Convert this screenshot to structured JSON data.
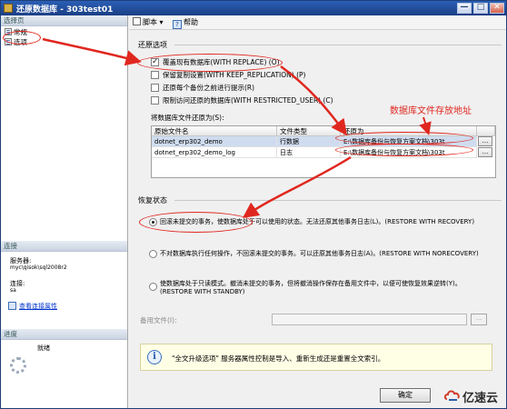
{
  "window": {
    "title": "还原数据库 - 303test01",
    "buttons": [
      "—",
      "□",
      "✕"
    ]
  },
  "left_pane": {
    "select_page_header": "选择页",
    "pages": [
      {
        "label": "常规"
      },
      {
        "label": "选项"
      }
    ],
    "connection_header": "连接",
    "server_label": "服务器:",
    "server_value": "myc\\qisok\\sql2008r2",
    "connection_label": "连接:",
    "connection_value": "sa",
    "view_connection_link": "查看连接属性",
    "progress_header": "进度",
    "progress_status": "就绪"
  },
  "toolbar": {
    "script_label": "脚本",
    "help_label": "帮助"
  },
  "restore_options": {
    "title": "还原选项",
    "options": [
      {
        "label": "覆盖现有数据库(WITH REPLACE) (O)",
        "checked": true
      },
      {
        "label": "保留复制设置(WITH KEEP_REPLICATION) (P)",
        "checked": false
      },
      {
        "label": "还原每个备份之前进行提示(R)",
        "checked": false
      },
      {
        "label": "限制访问还原的数据库(WITH RESTRICTED_USER) (C)",
        "checked": false
      }
    ],
    "restore_as_label": "将数据库文件还原为(S):",
    "grid": {
      "headers": [
        "原始文件名",
        "文件类型",
        "还原为",
        ""
      ],
      "rows": [
        {
          "original": "dotnet_erp302_demo",
          "type": "行数据",
          "restore_as": "E:\\数据库备份与恢复方案文档\\303t",
          "button": "..."
        },
        {
          "original": "dotnet_erp302_demo_log",
          "type": "日志",
          "restore_as": "E:\\数据库备份与恢复方案文档\\303t",
          "button": "..."
        }
      ]
    }
  },
  "recovery_state": {
    "title": "恢复状态",
    "options": [
      {
        "label": "回滚未提交的事务，使数据库处于可以使用的状态。无法还原其他事务日志(L)。(RESTORE WITH RECOVERY)",
        "selected": true
      },
      {
        "label": "不对数据库执行任何操作，不回滚未提交的事务。可以还原其他事务日志(A)。(RESTORE WITH NORECOVERY)",
        "selected": false
      },
      {
        "label_line1": "使数据库处于只读模式。撤消未提交的事务，但将撤消操作保存在备用文件中，以便可使恢复效果逆转(Y)。",
        "label_line2": "(RESTORE WITH STANDBY)",
        "selected": false
      }
    ],
    "standby_file_label": "备用文件(I):",
    "standby_file_value": "",
    "standby_browse": "..."
  },
  "info": {
    "icon": "i",
    "text": "\"全文升级选项\" 服务器属性控制是导入、重新生成还是重置全文索引。"
  },
  "footer": {
    "ok_label": "确定"
  },
  "annotation": {
    "label": "数据库文件存放地址",
    "color": "#e0271f"
  },
  "watermark": {
    "text": "亿速云"
  }
}
